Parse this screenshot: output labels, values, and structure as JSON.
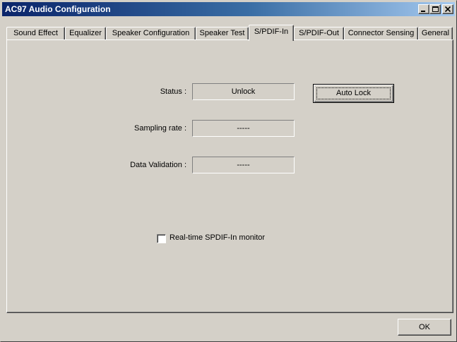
{
  "window": {
    "title": "AC97 Audio Configuration"
  },
  "tabs": [
    {
      "label": "Sound Effect"
    },
    {
      "label": "Equalizer"
    },
    {
      "label": "Speaker Configuration"
    },
    {
      "label": "Speaker Test"
    },
    {
      "label": "S/PDIF-In"
    },
    {
      "label": "S/PDIF-Out"
    },
    {
      "label": "Connector Sensing"
    },
    {
      "label": "General"
    }
  ],
  "active_tab": "S/PDIF-In",
  "spdif_in": {
    "status_label": "Status :",
    "status_value": "Unlock",
    "sampling_rate_label": "Sampling rate :",
    "sampling_rate_value": "-----",
    "data_validation_label": "Data Validation :",
    "data_validation_value": "-----",
    "auto_lock_button": "Auto Lock",
    "monitor_checkbox_label": "Real-time SPDIF-In monitor",
    "monitor_checked": false
  },
  "footer": {
    "ok_button": "OK"
  }
}
